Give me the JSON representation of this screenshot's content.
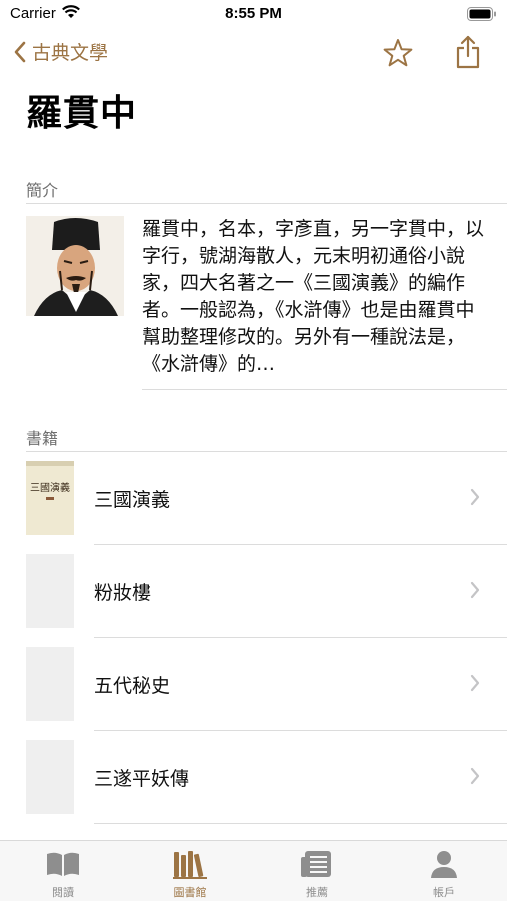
{
  "status": {
    "carrier": "Carrier",
    "time": "8:55 PM"
  },
  "nav": {
    "back_label": "古典文學"
  },
  "page": {
    "title": "羅貫中"
  },
  "intro": {
    "header": "簡介",
    "text": "羅貫中，名本，字彥直，另一字貫中，以字行，號湖海散人，元末明初通俗小說家，四大名著之一《三國演義》的編作者。一般認為，《水滸傳》也是由羅貫中幫助整理修改的。另外有一種說法是，《水滸傳》的…"
  },
  "books": {
    "header": "書籍",
    "items": [
      {
        "title": "三國演義",
        "cover_text": "三國演義"
      },
      {
        "title": "粉妝樓"
      },
      {
        "title": "五代秘史"
      },
      {
        "title": "三遂平妖傳"
      }
    ]
  },
  "tabs": [
    {
      "label": "閱讀",
      "icon": "book-icon"
    },
    {
      "label": "圖書館",
      "icon": "library-icon",
      "active": true
    },
    {
      "label": "推薦",
      "icon": "newspaper-icon"
    },
    {
      "label": "帳戶",
      "icon": "person-icon"
    }
  ],
  "colors": {
    "accent": "#9c7444",
    "inactive": "#8e8e8e"
  }
}
